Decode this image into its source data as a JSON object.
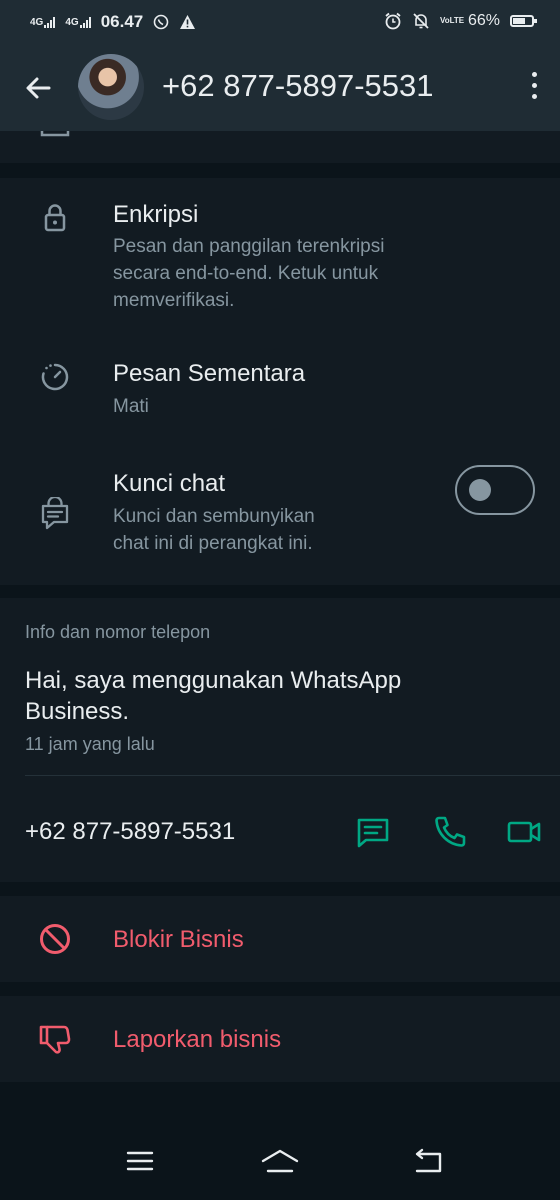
{
  "status": {
    "net1": "4G",
    "net2": "4G",
    "time": "06.47",
    "volte": "VoLTE",
    "battery_text": "66%",
    "battery_level": 0.66
  },
  "appbar": {
    "title": "+62 877-5897-5531"
  },
  "encryption": {
    "title": "Enkripsi",
    "subtitle_lines": [
      "Pesan dan panggilan terenkripsi",
      "secara end-to-end. Ketuk untuk",
      "memverifikasi."
    ]
  },
  "disappearing": {
    "title": "Pesan Sementara",
    "value": "Mati"
  },
  "chat_lock": {
    "title": "Kunci chat",
    "subtitle_lines": [
      "Kunci dan sembunyikan",
      "chat ini di perangkat ini."
    ],
    "enabled": false
  },
  "about": {
    "header": "Info dan nomor telepon",
    "text_lines": [
      "Hai, saya menggunakan WhatsApp",
      "Business."
    ],
    "time": "11 jam yang lalu",
    "phone": "+62 877-5897-5531"
  },
  "block": {
    "label": "Blokir Bisnis"
  },
  "report": {
    "label": "Laporkan bisnis"
  },
  "colors": {
    "accent": "#00a884",
    "danger": "#f15c6d",
    "panel": "#121b22",
    "background": "#0b141a",
    "bar": "#1f2c34"
  }
}
